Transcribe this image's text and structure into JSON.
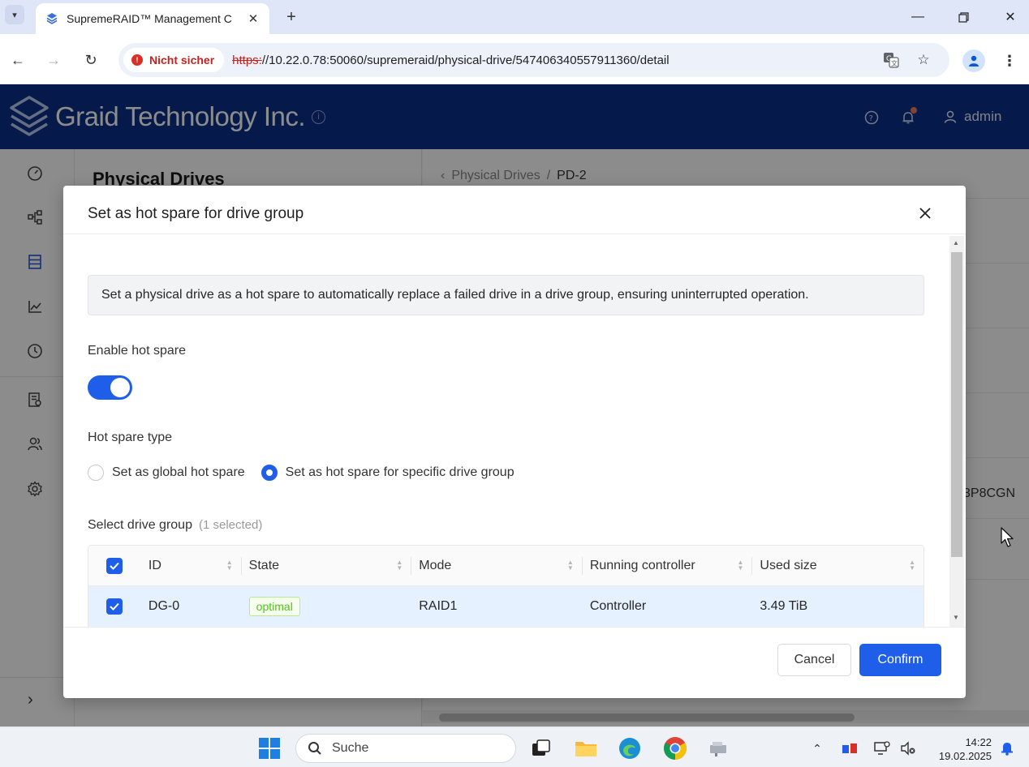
{
  "browser": {
    "tab_title": "SupremeRAID™ Management C",
    "security_label": "Nicht sicher",
    "url_scheme": "https:",
    "url_rest": "//10.22.0.78:50060/supremeraid/physical-drive/547406340557911360/detail"
  },
  "app": {
    "brand_name": "Graid Technology Inc.",
    "user_name": "admin",
    "left_panel_title": "Physical Drives",
    "breadcrumb": {
      "parent": "Physical Drives",
      "separator": "/",
      "current": "PD-2"
    },
    "background_serial_fragment": "3P8CGN"
  },
  "modal": {
    "title": "Set as hot spare for drive group",
    "info_text": "Set a physical drive as a hot spare to automatically replace a failed drive in a drive group, ensuring uninterrupted operation.",
    "enable_label": "Enable hot spare",
    "enable_value": true,
    "type_label": "Hot spare type",
    "radio_global": "Set as global hot spare",
    "radio_specific": "Set as hot spare for specific drive group",
    "selected_type": "specific",
    "select_group_label": "Select drive group",
    "selected_count": "(1 selected)",
    "table": {
      "columns": [
        "ID",
        "State",
        "Mode",
        "Running controller",
        "Used size"
      ],
      "rows": [
        {
          "id": "DG-0",
          "state": "optimal",
          "mode": "RAID1",
          "controller": "Controller",
          "used_size": "3.49 TiB",
          "checked": true
        }
      ]
    },
    "cancel_label": "Cancel",
    "confirm_label": "Confirm"
  },
  "taskbar": {
    "search_placeholder": "Suche",
    "time": "14:22",
    "date": "19.02.2025"
  },
  "colors": {
    "header_bg": "#0a3187",
    "primary": "#1f5ee8",
    "tag_success": "#52c41a",
    "insecure_red": "#c5221f"
  }
}
